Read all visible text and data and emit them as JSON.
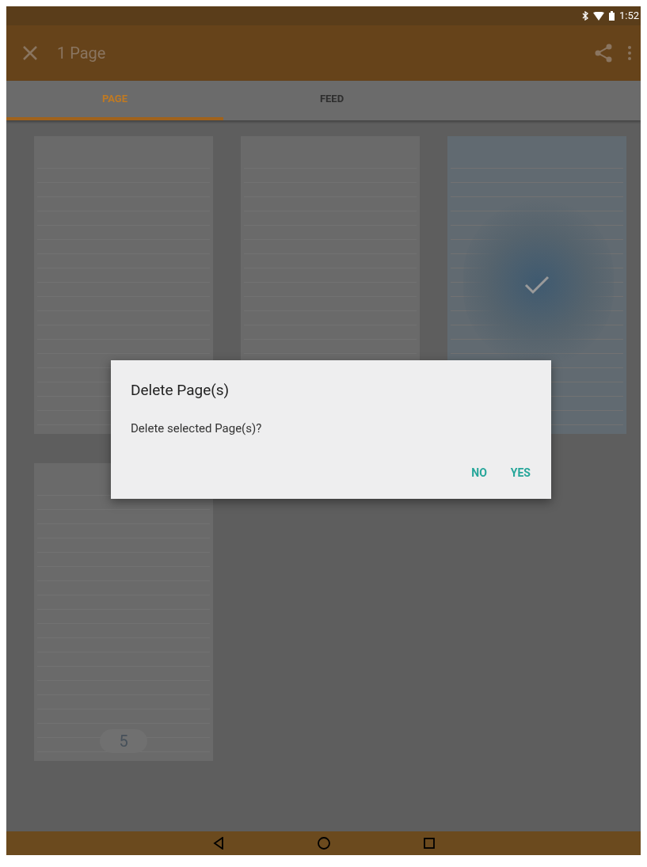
{
  "status_bar": {
    "time": "1:52"
  },
  "app_bar": {
    "title": "1 Page"
  },
  "tabs": [
    {
      "label": "PAGE",
      "selected": true
    },
    {
      "label": "FEED",
      "selected": false
    }
  ],
  "pages": [
    {
      "selected": false
    },
    {
      "selected": false
    },
    {
      "selected": true
    },
    {
      "selected": false,
      "page_number": "5"
    }
  ],
  "dialog": {
    "title": "Delete Page(s)",
    "message": "Delete selected Page(s)?",
    "buttons": [
      "NO",
      "YES"
    ]
  }
}
